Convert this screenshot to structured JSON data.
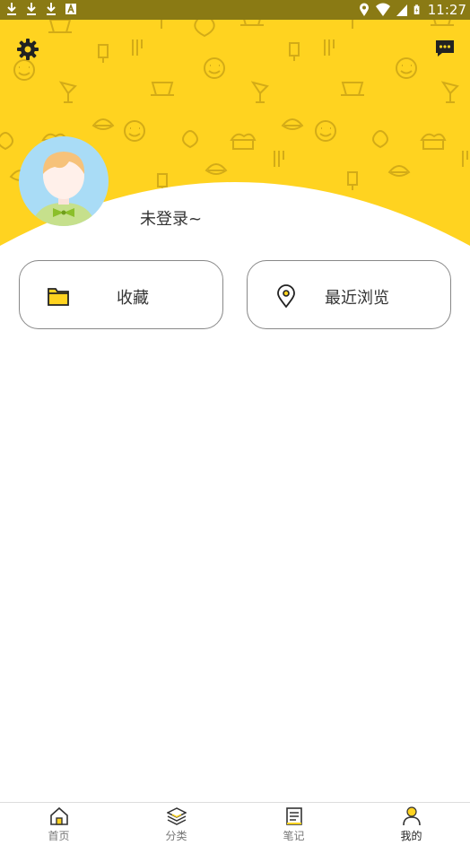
{
  "status_bar": {
    "time": "11:27"
  },
  "profile": {
    "login_text": "未登录~"
  },
  "actions": {
    "favorites_label": "收藏",
    "recent_label": "最近浏览"
  },
  "nav": {
    "items": [
      {
        "label": "首页",
        "icon": "home-icon"
      },
      {
        "label": "分类",
        "icon": "layers-icon"
      },
      {
        "label": "笔记",
        "icon": "notebook-icon"
      },
      {
        "label": "我的",
        "icon": "person-icon"
      }
    ],
    "active": "我的"
  },
  "colors": {
    "brand_yellow": "#ffd320",
    "status_bar": "#8a7a14",
    "text": "#333333"
  }
}
